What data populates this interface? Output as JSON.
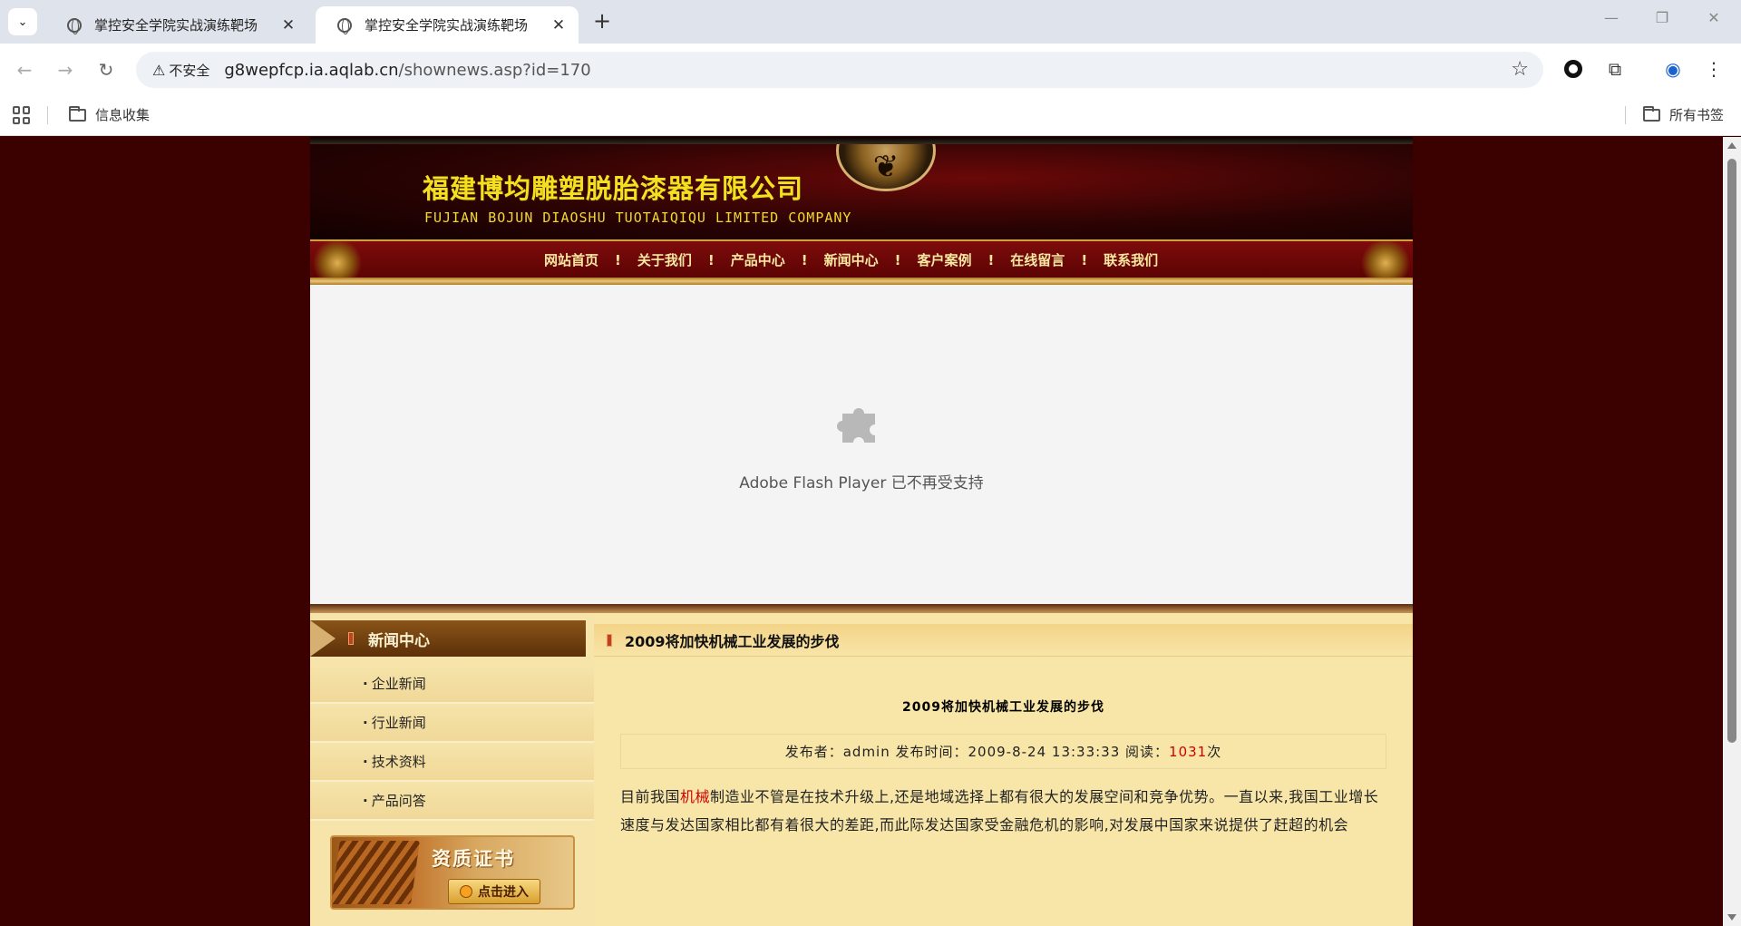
{
  "browser": {
    "tabs": [
      {
        "title": "掌控安全学院实战演练靶场",
        "active": false
      },
      {
        "title": "掌控安全学院实战演练靶场",
        "active": true
      }
    ],
    "security_label": "不安全",
    "url_host": "g8wepfcp.ia.aqlab.cn",
    "url_path": "/shownews.asp?id=170",
    "bookmarks": {
      "left_folder": "信息收集",
      "right_folder": "所有书签"
    }
  },
  "site": {
    "company_cn": "福建博均雕塑脱胎漆器有限公司",
    "company_en": "FUJIAN BOJUN DIAOSHU  TUOTAIQIQU  LIMITED COMPANY",
    "nav": [
      "网站首页",
      "关于我们",
      "产品中心",
      "新闻中心",
      "客户案例",
      "在线留言",
      "联系我们"
    ],
    "nav_separator": "!",
    "flash_message": "Adobe Flash Player 已不再受支持",
    "sidebar": {
      "heading": "新闻中心",
      "items": [
        "企业新闻",
        "行业新闻",
        "技术资料",
        "产品问答"
      ],
      "cert_title": "资质证书",
      "cert_button": "点击进入"
    },
    "article": {
      "header_title": "2009将加快机械工业发展的步伐",
      "title": "2009将加快机械工业发展的步伐",
      "meta_prefix": "发布者：admin 发布时间：2009-8-24 13:33:33 阅读：",
      "read_count": "1031",
      "meta_suffix": "次",
      "body_pre": "目前我国",
      "body_keyword": "机械",
      "body_post": "制造业不管是在技术升级上,还是地域选择上都有很大的发展空间和竞争优势。一直以来,我国工业增长速度与发达国家相比都有着很大的差距,而此际发达国家受金融危机的影响,对发展中国家来说提供了赶超的机会"
    }
  },
  "colors": {
    "page_background": "#3b0101",
    "title_yellow": "#f5e020",
    "highlight_red": "#d00000"
  }
}
